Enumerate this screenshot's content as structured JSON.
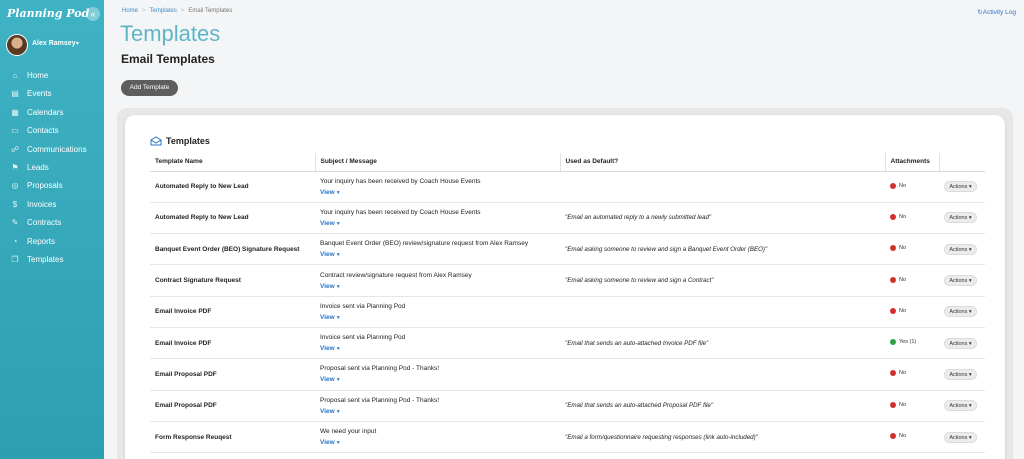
{
  "sidebar": {
    "brand": "Planning Pod",
    "collapse_icon": "«",
    "user": {
      "name": "Alex Ramsey",
      "caret": "▾"
    },
    "items": [
      {
        "label": "Home",
        "icon": "⌂",
        "icon_name": "home-icon"
      },
      {
        "label": "Events",
        "icon": "▤",
        "icon_name": "events-icon"
      },
      {
        "label": "Calendars",
        "icon": "▦",
        "icon_name": "calendar-icon"
      },
      {
        "label": "Contacts",
        "icon": "▭",
        "icon_name": "contacts-icon"
      },
      {
        "label": "Communications",
        "icon": "☍",
        "icon_name": "communications-icon"
      },
      {
        "label": "Leads",
        "icon": "⚑",
        "icon_name": "leads-icon"
      },
      {
        "label": "Proposals",
        "icon": "◎",
        "icon_name": "proposals-icon"
      },
      {
        "label": "Invoices",
        "icon": "$",
        "icon_name": "invoices-icon"
      },
      {
        "label": "Contracts",
        "icon": "✎",
        "icon_name": "contracts-icon"
      },
      {
        "label": "Reports",
        "icon": "◔",
        "icon_name": "reports-icon"
      },
      {
        "label": "Templates",
        "icon": "❐",
        "icon_name": "templates-icon"
      }
    ]
  },
  "breadcrumb": {
    "home": "Home",
    "templates": "Templates",
    "current": "Email Templates",
    "sep": ">"
  },
  "activity_log": "Activity Log",
  "page": {
    "title": "Templates",
    "subtitle": "Email Templates",
    "add_button": "Add Template"
  },
  "panel": {
    "title": "Templates",
    "columns": [
      "Template Name",
      "Subject / Message",
      "Used as Default?",
      "Attachments",
      ""
    ],
    "view_label": "View",
    "actions_label": "Actions ▾",
    "rows": [
      {
        "name": "Automated Reply to New Lead",
        "subject": "Your inquiry has been received by Coach House Events",
        "default": "",
        "attachments": "No",
        "att_color": "#d0312d"
      },
      {
        "name": "Automated Reply to New Lead",
        "subject": "Your inquiry has been received by Coach House Events",
        "default": "\"Email an automated reply to a newly submitted lead\"",
        "attachments": "No",
        "att_color": "#d0312d"
      },
      {
        "name": "Banquet Event Order (BEO) Signature Request",
        "subject": "Banquet Event Order (BEO) review/signature request from Alex Ramsey",
        "default": "\"Email asking someone to review and sign a Banquet Event Order (BEO)\"",
        "attachments": "No",
        "att_color": "#d0312d"
      },
      {
        "name": "Contract Signature Request",
        "subject": "Contract review/signature request from Alex Ramsey",
        "default": "\"Email asking someone to review and sign a Contract\"",
        "attachments": "No",
        "att_color": "#d0312d"
      },
      {
        "name": "Email Invoice PDF",
        "subject": "Invoice sent via Planning Pod",
        "default": "",
        "attachments": "No",
        "att_color": "#d0312d"
      },
      {
        "name": "Email Invoice PDF",
        "subject": "Invoice sent via Planning Pod",
        "default": "\"Email that sends an auto-attached Invoice PDF file\"",
        "attachments": "Yes (1)",
        "att_color": "#2ea043"
      },
      {
        "name": "Email Proposal PDF",
        "subject": "Proposal sent via Planning Pod - Thanks!",
        "default": "",
        "attachments": "No",
        "att_color": "#d0312d"
      },
      {
        "name": "Email Proposal PDF",
        "subject": "Proposal sent via Planning Pod - Thanks!",
        "default": "\"Email that sends an auto-attached Proposal PDF file\"",
        "attachments": "No",
        "att_color": "#d0312d"
      },
      {
        "name": "Form Response Reuqest",
        "subject": "We need your input",
        "default": "\"Email a form/questionnaire requesting responses (link auto-included)\"",
        "attachments": "No",
        "att_color": "#d0312d"
      }
    ]
  }
}
